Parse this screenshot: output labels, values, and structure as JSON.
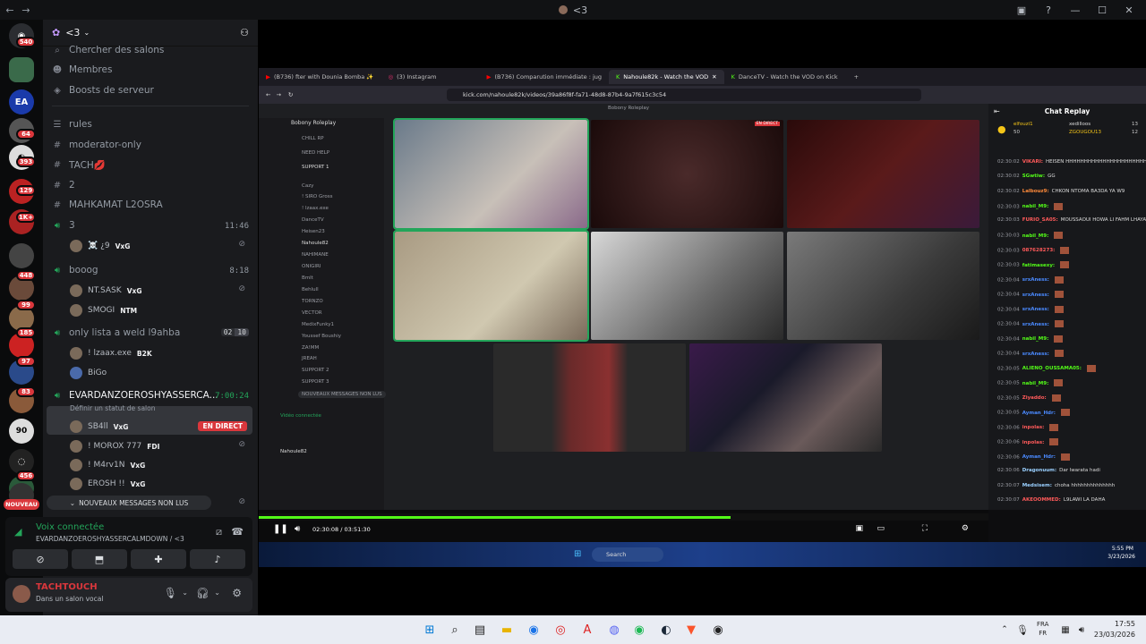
{
  "titlebar": {
    "title": "<3"
  },
  "server": {
    "name": "<3"
  },
  "guild_badges": [
    "540",
    "64",
    "393",
    "129",
    "1K+",
    "448",
    "99",
    "185",
    "97",
    "83",
    "456",
    "NOUVEAU"
  ],
  "channels": {
    "search": "Chercher des salons",
    "members": "Membres",
    "boosts": "Boosts de serveur",
    "list": [
      {
        "name": "rules",
        "icon": "rules-icon"
      },
      {
        "name": "moderator-only",
        "icon": "hash-icon"
      },
      {
        "name": "TACH💋",
        "icon": "hash-icon"
      },
      {
        "name": "2",
        "icon": "hash-icon"
      },
      {
        "name": "MAHKAMAT L2OSRA",
        "icon": "hash-icon"
      }
    ],
    "voice": [
      {
        "name": "3",
        "time": "11:46",
        "users": [
          {
            "name": "☠️ ¿9",
            "tag": "VxG"
          }
        ]
      },
      {
        "name": "booog",
        "time": "8:18",
        "users": [
          {
            "name": "NT.SASK",
            "tag": "VxG"
          },
          {
            "name": "SMOGI",
            "tag": "NTM"
          }
        ]
      },
      {
        "name": "only lista a weld l9ahba",
        "count_a": "02",
        "count_b": "10",
        "users": [
          {
            "name": "! lzaax.exe",
            "tag": "B2K"
          },
          {
            "name": "BiGo",
            "tag": ""
          }
        ]
      },
      {
        "name": "EVARDANZOEROSHYASSERCA...",
        "time": "7:00:24",
        "status": "Définir un statut de salon",
        "users": [
          {
            "name": "SB4ll",
            "tag": "VxG",
            "live": "EN DIRECT"
          },
          {
            "name": "! MOROX 777",
            "tag": "FDI"
          },
          {
            "name": "! M4rv1N",
            "tag": "VxG"
          },
          {
            "name": "EROSH !!",
            "tag": "VxG"
          }
        ]
      }
    ],
    "unread": "NOUVEAUX MESSAGES NON LUS"
  },
  "voice_panel": {
    "status": "Voix connectée",
    "channel": "EVARDANZOEROSHYASSERCALMDOWN / <3"
  },
  "user_panel": {
    "name": "TACHTOUCH",
    "status": "Dans un salon vocal"
  },
  "browser": {
    "tabs": [
      "(B736) fter with Dounia Bomba ✨",
      "(3) Instagram",
      "(B736) Comparution immédiate : jug",
      "Nahoule82k - Watch the VOD",
      "DanceTV - Watch the VOD on Kick"
    ],
    "url": "kick.com/nahoule82k/videos/39a86f8f-fa71-48d8-87b4-9a7f615c3c54"
  },
  "inner_discord": {
    "server": "Bobony Roleplay",
    "channels": [
      "CHILL RP",
      "NEED HELP",
      "SUPPORT 1",
      "SUPPORT 2",
      "SUPPORT 3"
    ],
    "users": [
      "Cazy",
      "! SIRO Gross",
      "! lzaax.exe",
      "DanceTV",
      "Heisen23",
      "Nahoule82",
      "NAHIMANE",
      "ONIGIRI",
      "Bmlt",
      "Behlull",
      "TORNZO",
      "VECTOR",
      "MedixFunky1",
      "Youssef Boushiy",
      "ZA!MM",
      "JREAH"
    ],
    "voice_connected": "Vidéo connectée",
    "self": "Nahoule82",
    "unread": "NOUVEAUX MESSAGES NON LUS"
  },
  "chat": {
    "title": "Chat Replay",
    "top": [
      {
        "name": "elfouzi1",
        "count": "50"
      },
      {
        "name": "xedilloos",
        "count": "13"
      },
      {
        "name": "ZGOUGOU13",
        "count": "12"
      }
    ],
    "messages": [
      {
        "time": "02:30:02",
        "user": "VIKARI:",
        "text": "HEISEN HHHHHHHHHHHHHHHHHHHHHHHHHHHHHH"
      },
      {
        "time": "02:30:02",
        "user": "SGwtiw:",
        "text": "GG"
      },
      {
        "time": "02:30:02",
        "user": "Lalbouz9:",
        "text": "CHKON NTOMA BA3DA YA W9"
      },
      {
        "time": "02:30:03",
        "user": "nabil_M9:",
        "text": ""
      },
      {
        "time": "02:30:03",
        "user": "FURIO_SA05:",
        "text": "MOUSSAOUI HOWA LI FAHM LHAYAT"
      },
      {
        "time": "02:30:03",
        "user": "nabil_M9:",
        "text": ""
      },
      {
        "time": "02:30:03",
        "user": "087628273:",
        "text": ""
      },
      {
        "time": "02:30:03",
        "user": "fatimasexy:",
        "text": ""
      },
      {
        "time": "02:30:04",
        "user": "srxAness:",
        "text": ""
      },
      {
        "time": "02:30:04",
        "user": "srxAness:",
        "text": ""
      },
      {
        "time": "02:30:04",
        "user": "srxAness:",
        "text": ""
      },
      {
        "time": "02:30:04",
        "user": "srxAness:",
        "text": ""
      },
      {
        "time": "02:30:04",
        "user": "nabil_M9:",
        "text": ""
      },
      {
        "time": "02:30:04",
        "user": "srxAness:",
        "text": ""
      },
      {
        "time": "02:30:05",
        "user": "ALIENO_OUSSAMA05:",
        "text": ""
      },
      {
        "time": "02:30:05",
        "user": "nabil_M9:",
        "text": ""
      },
      {
        "time": "02:30:05",
        "user": "Ziyaddo:",
        "text": ""
      },
      {
        "time": "02:30:05",
        "user": "Ayman_Hdr:",
        "text": ""
      },
      {
        "time": "02:30:06",
        "user": "inpolas:",
        "text": ""
      },
      {
        "time": "02:30:06",
        "user": "inpolas:",
        "text": ""
      },
      {
        "time": "02:30:06",
        "user": "Ayman_Hdr:",
        "text": ""
      },
      {
        "time": "02:30:06",
        "user": "Dragonuum:",
        "text": "Dar lwarata hadi"
      },
      {
        "time": "02:30:07",
        "user": "Medsisem:",
        "text": "choha hhhhhhhhhhhhhh"
      },
      {
        "time": "02:30:07",
        "user": "AKEOOMMED:",
        "text": "L9LAWI LA DAHA"
      }
    ]
  },
  "player": {
    "time": "02:30:08 / 03:51:30",
    "progress": 0.647
  },
  "inner_taskbar": {
    "search": "Search",
    "clock_time": "5:55 PM",
    "clock_date": "3/23/2026"
  },
  "taskbar": {
    "lang": "FRA",
    "lang2": "FR",
    "time": "17:55",
    "date": "23/03/2026"
  }
}
